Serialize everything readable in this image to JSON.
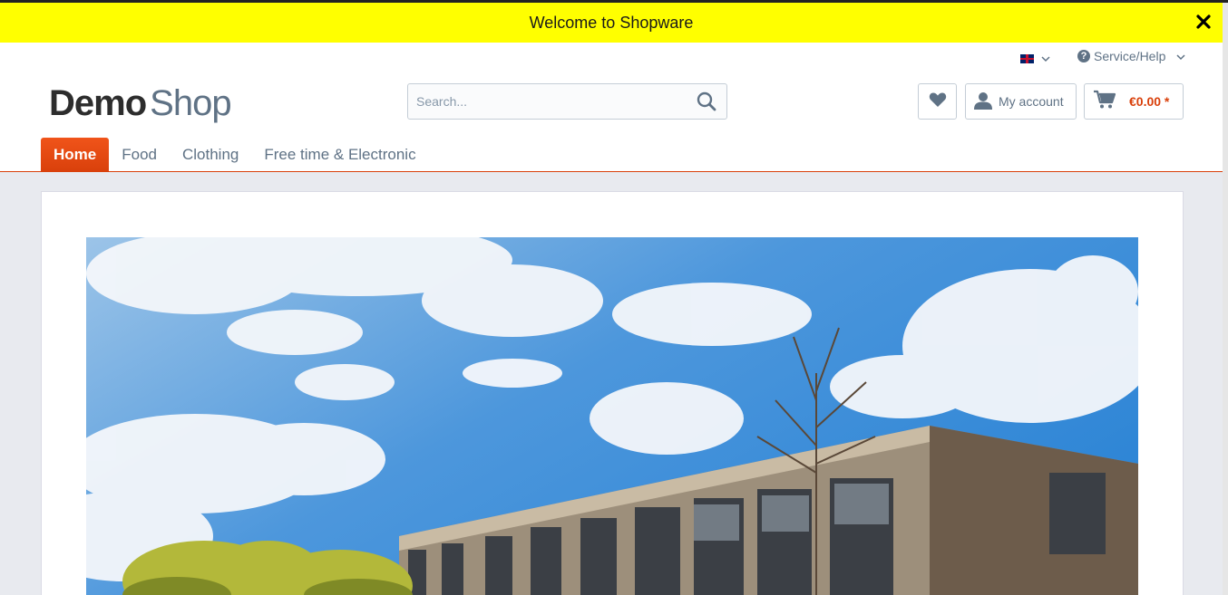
{
  "welcome": {
    "text": "Welcome to Shopware"
  },
  "header": {
    "service_label": "Service/Help",
    "logo_demo": "Demo",
    "logo_shop": "Shop",
    "search_placeholder": "Search...",
    "account_label": "My account",
    "cart_amount": "€0.00 *"
  },
  "nav": {
    "items": [
      {
        "label": "Home"
      },
      {
        "label": "Food"
      },
      {
        "label": "Clothing"
      },
      {
        "label": "Free time & Electronic"
      }
    ]
  },
  "colors": {
    "welcome_bg": "#ffff00",
    "accent": "#d9400b",
    "text": "#5f7285"
  },
  "icons": [
    "close-icon",
    "flag-uk-icon",
    "chevron-down-icon",
    "help-circle-icon",
    "search-icon",
    "heart-icon",
    "user-icon",
    "cart-icon"
  ]
}
